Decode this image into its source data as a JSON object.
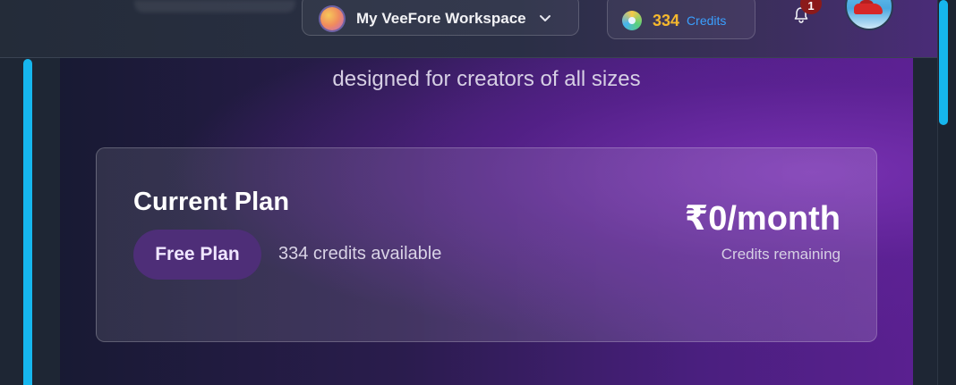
{
  "header": {
    "workspace_label": "My VeeFore Workspace",
    "credits_value": "334",
    "credits_label": "Credits",
    "notification_count": "1"
  },
  "main": {
    "subtitle": "designed for creators of all sizes",
    "card": {
      "title": "Current Plan",
      "plan_name": "Free Plan",
      "credits_available": "334 credits available",
      "price": "₹0/month",
      "price_caption": "Credits remaining"
    }
  },
  "colors": {
    "accent": "#16b6ee",
    "credits_number": "#f5b82e",
    "credits_label": "#3aa0ff",
    "badge": "#8b1a1a"
  }
}
